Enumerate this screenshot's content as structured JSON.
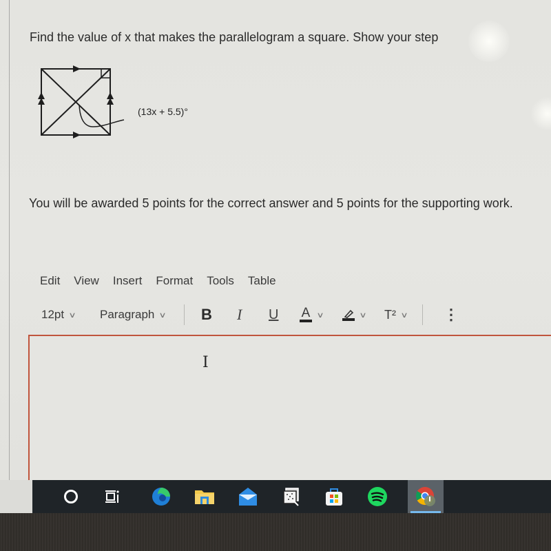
{
  "question": {
    "prompt": "Find the value of x that makes the parallelogram a square. Show your step",
    "angle_label": "(13x + 5.5)°",
    "points_text": "You will be awarded 5 points for the correct answer and 5 points for the supporting work."
  },
  "editor": {
    "menu": [
      "Edit",
      "View",
      "Insert",
      "Format",
      "Tools",
      "Table"
    ],
    "font_size": "12pt",
    "block_format": "Paragraph",
    "bold_label": "B",
    "italic_label": "I",
    "underline_label": "U",
    "text_color_label": "A",
    "superscript_label": "T²",
    "more_label": "⋮",
    "content": "",
    "accent_color": "#c0543c"
  },
  "taskbar": {
    "apps": [
      {
        "name": "search",
        "icon": "cortana-circle-icon"
      },
      {
        "name": "task-view",
        "icon": "task-view-icon"
      },
      {
        "name": "edge",
        "icon": "edge-icon"
      },
      {
        "name": "file-explorer",
        "icon": "folder-icon"
      },
      {
        "name": "mail",
        "icon": "mail-icon"
      },
      {
        "name": "photos",
        "icon": "photos-icon"
      },
      {
        "name": "microsoft-store",
        "icon": "store-icon"
      },
      {
        "name": "spotify",
        "icon": "spotify-icon"
      },
      {
        "name": "chrome",
        "icon": "chrome-icon",
        "active": true
      }
    ],
    "active_indicator_color": "#76b9ed"
  }
}
